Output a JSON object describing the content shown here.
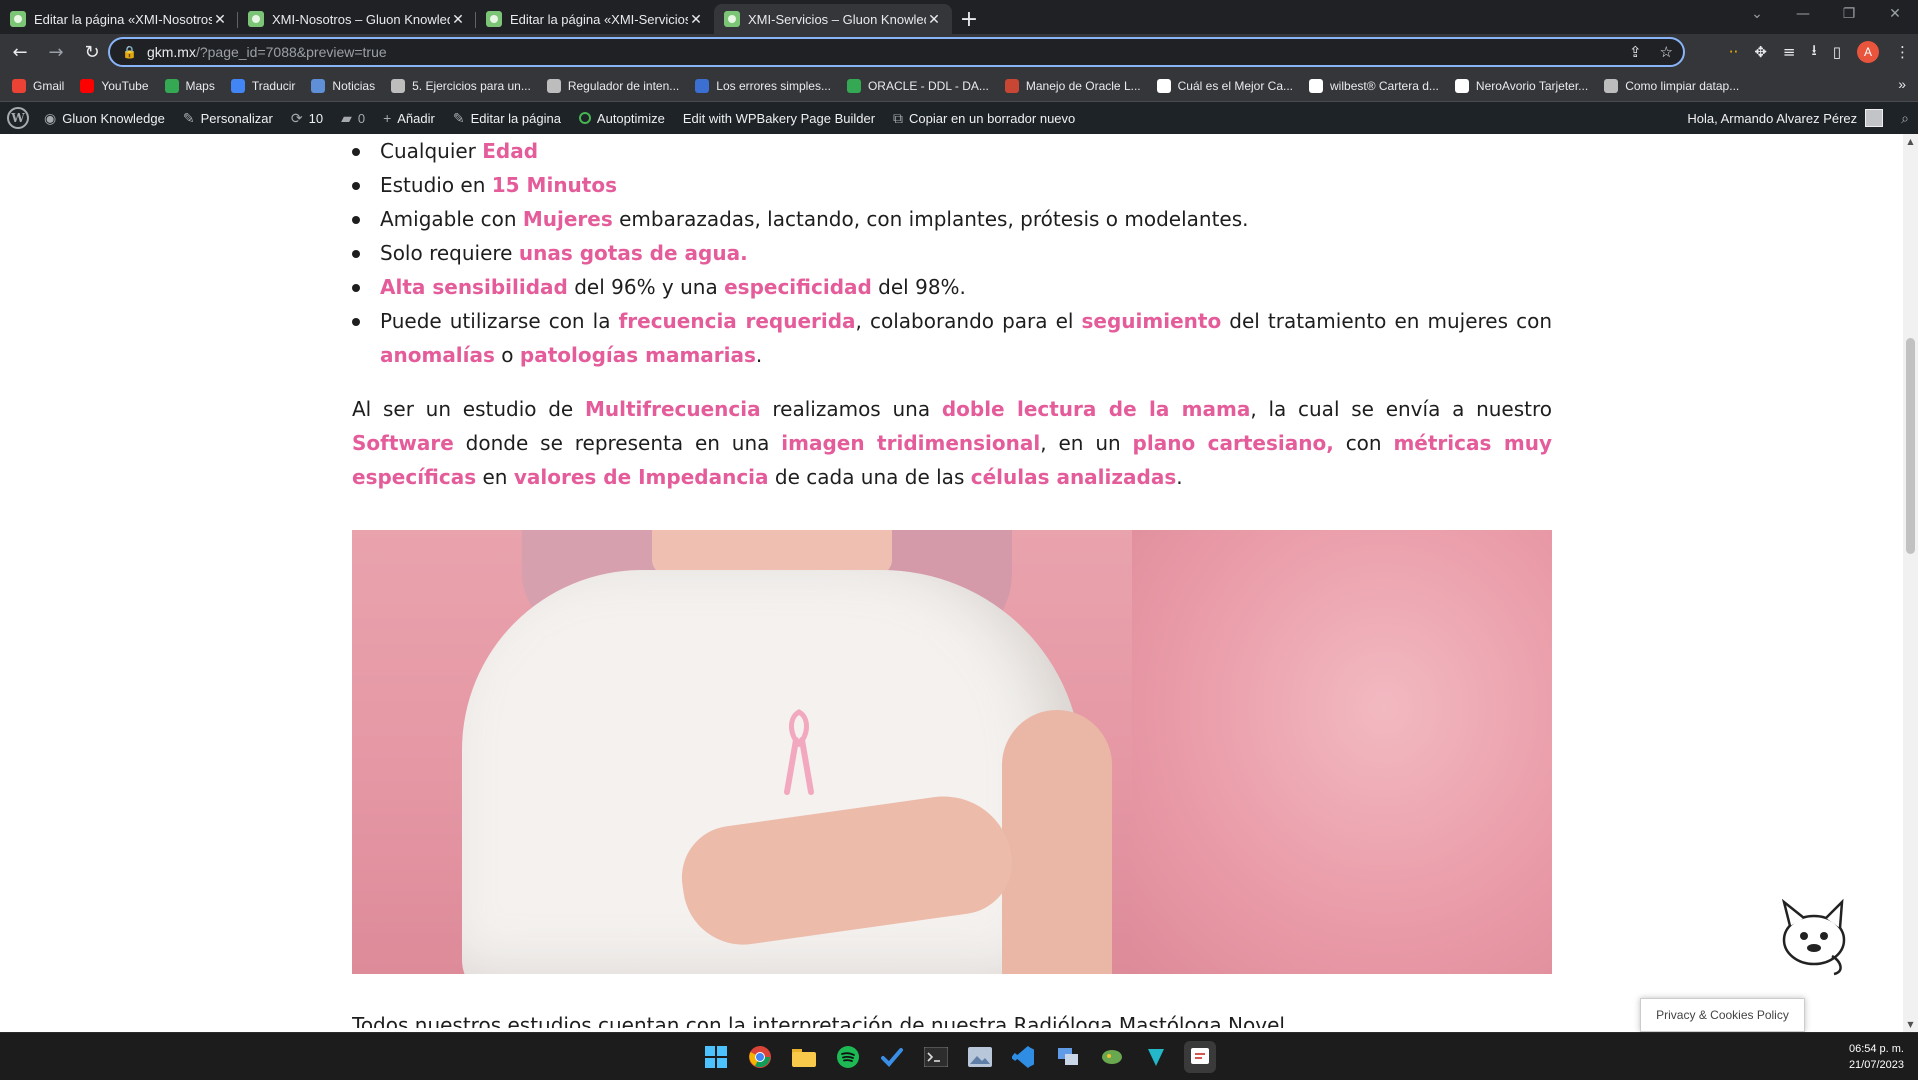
{
  "browser": {
    "tabs": [
      {
        "title": "Editar la página «XMI-Nosotros»",
        "active": false
      },
      {
        "title": "XMI-Nosotros – Gluon Knowledge",
        "active": false
      },
      {
        "title": "Editar la página «XMI-Servicios»",
        "active": false
      },
      {
        "title": "XMI-Servicios – Gluon Knowledge",
        "active": true
      }
    ],
    "new_tab": "+",
    "url_host": "gkm.mx",
    "url_rest": "/?page_id=7088&preview=true",
    "profile_initial": "A",
    "bookmarks": [
      {
        "label": "Gmail",
        "color": "#ea4335"
      },
      {
        "label": "YouTube",
        "color": "#ff0000"
      },
      {
        "label": "Maps",
        "color": "#34a853"
      },
      {
        "label": "Traducir",
        "color": "#4285f4"
      },
      {
        "label": "Noticias",
        "color": "#5f8fd6"
      },
      {
        "label": "5. Ejercicios para un...",
        "color": "#bdbdbd"
      },
      {
        "label": "Regulador de inten...",
        "color": "#bdbdbd"
      },
      {
        "label": "Los errores simples...",
        "color": "#3b6fd1"
      },
      {
        "label": "ORACLE - DDL - DA...",
        "color": "#34a853"
      },
      {
        "label": "Manejo de Oracle L...",
        "color": "#c74634"
      },
      {
        "label": "Cuál es el Mejor Ca...",
        "color": "#ffffff"
      },
      {
        "label": "wilbest® Cartera d...",
        "color": "#ffffff"
      },
      {
        "label": "NeroAvorio Tarjeter...",
        "color": "#ffffff"
      },
      {
        "label": "Como limpiar datap...",
        "color": "#bdbdbd"
      }
    ]
  },
  "wpbar": {
    "site": "Gluon Knowledge",
    "customize": "Personalizar",
    "updates": "10",
    "comments": "0",
    "add_new": "Añadir",
    "edit_page": "Editar la página",
    "autoptimize": "Autoptimize",
    "wpbakery": "Edit with WPBakery Page Builder",
    "copy_draft": "Copiar en un borrador nuevo",
    "greeting": "Hola, Armando Alvarez Pérez"
  },
  "content": {
    "bullets": {
      "b1": {
        "pre": "Cualquier ",
        "hl": "Edad"
      },
      "b2": {
        "pre": "Estudio en ",
        "hl": "15 Minutos"
      },
      "b3": {
        "pre": "Amigable con ",
        "hl": "Mujeres",
        "post": " embarazadas, lactando, con implantes, prótesis o modelantes."
      },
      "b4": {
        "pre": "Solo requiere ",
        "hl": "unas gotas de agua."
      },
      "b5": {
        "hl1": "Alta sensibilidad",
        "mid": " del 96% y una ",
        "hl2": "especificidad",
        "post": " del 98%."
      },
      "b6": {
        "pre": " Puede utilizarse con la ",
        "hl1": "frecuencia requerida",
        "mid1": ", colaborando para el ",
        "hl2": "seguimiento",
        "mid2": " del tratamiento en mujeres con ",
        "hl3": "anomalías",
        "mid3": " o ",
        "hl4": "patologías mamarias",
        "post": "."
      }
    },
    "paragraph": {
      "t1": "Al ser un estudio de ",
      "h1": "Multifrecuencia",
      "t2": " realizamos una ",
      "h2": "doble lectura de la mama",
      "t3": ", la cual se envía a nuestro ",
      "h3": "Software",
      "t4": " donde se representa en una ",
      "h4": "imagen tridimensional",
      "t5": ", en un ",
      "h5": "plano cartesiano,",
      "t6": " con ",
      "h6": "métricas muy específicas",
      "t7": " en ",
      "h7": "valores de Impedancia",
      "t8": " de cada una de las ",
      "h8": "células analizadas",
      "t9": "."
    },
    "cut_line": "Todos nuestros estudios cuentan con la interpretación de nuestra Radióloga Mastóloga Novel"
  },
  "privacy": "Privacy & Cookies Policy",
  "clock": {
    "time": "06:54 p. m.",
    "date": "21/07/2023"
  },
  "colors": {
    "highlight": "#e45c9a",
    "admin_bar": "#1d2327",
    "browser_dark": "#202124"
  }
}
